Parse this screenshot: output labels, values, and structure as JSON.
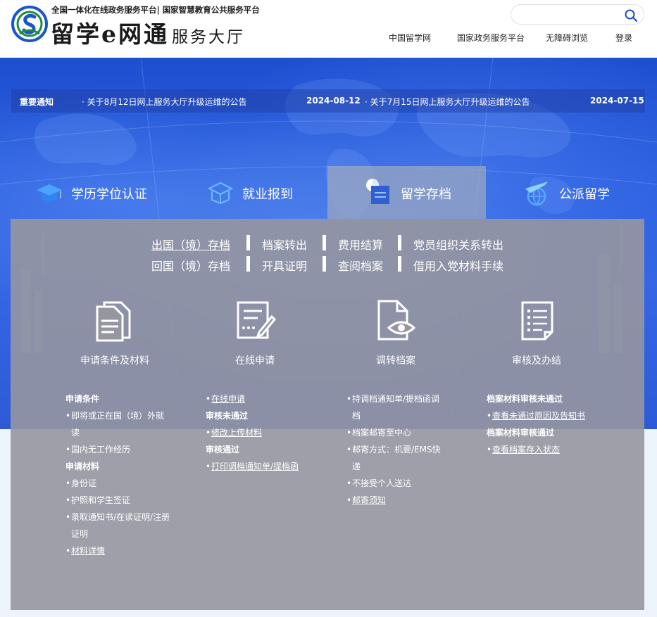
{
  "header": {
    "logo_subtitle": "全国一体化在线政务服务平台| 国家智慧教育公共服务平台",
    "logo_title_part1": "留学",
    "logo_title_e": "e",
    "logo_title_part2": "网通",
    "logo_title_hall": "服务大厅",
    "search_placeholder": "",
    "nav": [
      "中国留学网",
      "国家政务服务平台",
      "无障碍浏览",
      "登录"
    ]
  },
  "notice": {
    "label": "重要通知",
    "items": [
      {
        "text": "· 关于8月12日网上服务大厅升级运维的公告",
        "date": "2024-08-12"
      },
      {
        "text": "· 关于7月15日网上服务大厅升级运维的公告",
        "date": "2024-07-15"
      }
    ]
  },
  "tabs": [
    {
      "label": "学历学位认证",
      "icon": "graduation-cap-icon",
      "active": false
    },
    {
      "label": "就业报到",
      "icon": "hat-book-icon",
      "active": false
    },
    {
      "label": "留学存档",
      "icon": "archive-folder-icon",
      "active": true
    },
    {
      "label": "公派留学",
      "icon": "plane-globe-icon",
      "active": false
    }
  ],
  "sub_links": {
    "row1": [
      "出国（境）存档",
      "档案转出",
      "费用结算",
      "党员组织关系转出"
    ],
    "row2": [
      "回国（境）存档",
      "开具证明",
      "查阅档案",
      "借用入党材料手续"
    ]
  },
  "steps": [
    {
      "title": "申请条件及材料",
      "icon": "documents-icon"
    },
    {
      "title": "在线申请",
      "icon": "form-edit-icon"
    },
    {
      "title": "调转档案",
      "icon": "file-view-icon"
    },
    {
      "title": "审核及办结",
      "icon": "checklist-icon"
    }
  ],
  "col1": {
    "h1": "申请条件",
    "c1": "即将或正在国（境）外就读",
    "c2": "国内无工作经历",
    "h2": "申请材料",
    "m1": "身份证",
    "m2": "护照和学生签证",
    "m3": "录取通知书/在读证明/注册证明",
    "m4": "材料详情"
  },
  "col2": {
    "l1": "在线申请",
    "h1": "审核未通过",
    "l2": "修改上传材料",
    "h2": "审核通过",
    "l3": "打印调档通知单/提档函"
  },
  "col3": {
    "i1": "持调档通知单/提档函调档",
    "i2": "档案邮寄至中心",
    "i3": "邮寄方式：机要/EMS快递",
    "i4": "不接受个人送达",
    "l1": "邮寄须知"
  },
  "col4": {
    "h1": "档案材料审核未通过",
    "l1": "查看未通过原因及告知书",
    "h2": "档案材料审核通过",
    "l2": "查看档案存入状态"
  },
  "colors": {
    "primary": "#2b5fe0",
    "logo_green": "#1f8a3a",
    "logo_blue": "#1a56c8"
  }
}
